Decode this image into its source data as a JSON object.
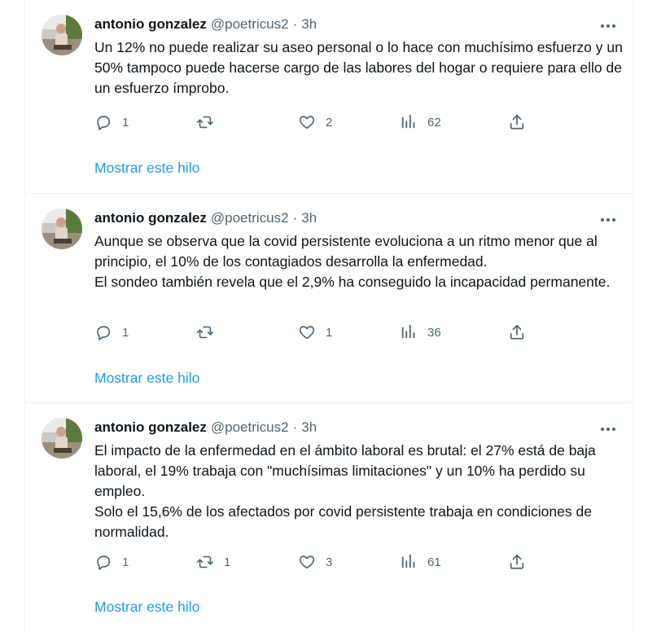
{
  "tweets": [
    {
      "author": {
        "name": "antonio gonzalez",
        "handle": "@poetricus2",
        "separator": "·",
        "time": "3h"
      },
      "text": [
        "Un 12% no puede realizar su aseo personal o lo hace con muchísimo esfuerzo y un 50% tampoco puede hacerse cargo de las labores del hogar o requiere para ello de un esfuerzo ímprobo."
      ],
      "replies": "1",
      "retweets": "",
      "likes": "2",
      "views": "62",
      "show_thread": "Mostrar este hilo"
    },
    {
      "author": {
        "name": "antonio gonzalez",
        "handle": "@poetricus2",
        "separator": "·",
        "time": "3h"
      },
      "text": [
        "Aunque se observa que la covid persistente evoluciona a un ritmo menor que al principio, el 10% de los contagiados desarrolla la enfermedad.",
        "El sondeo también revela que el 2,9% ha conseguido la incapacidad permanente."
      ],
      "replies": "1",
      "retweets": "",
      "likes": "1",
      "views": "36",
      "show_thread": "Mostrar este hilo"
    },
    {
      "author": {
        "name": "antonio gonzalez",
        "handle": "@poetricus2",
        "separator": "·",
        "time": "3h"
      },
      "text": [
        "El impacto de la enfermedad en el ámbito laboral es brutal: el 27% está de baja laboral, el 19% trabaja con \"muchísimas limitaciones\" y un 10% ha perdido su empleo.",
        "Solo el 15,6% de los afectados por covid persistente trabaja en condiciones de normalidad."
      ],
      "replies": "1",
      "retweets": "1",
      "likes": "3",
      "views": "61",
      "show_thread": "Mostrar este hilo"
    }
  ],
  "icons": {
    "reply": "reply-icon",
    "retweet": "retweet-icon",
    "like": "heart-icon",
    "views": "views-icon",
    "share": "share-icon",
    "more": "more-icon"
  },
  "colors": {
    "text": "#0f1419",
    "secondary": "#536471",
    "link": "#1d9bf0",
    "divider": "#eff3f4"
  }
}
